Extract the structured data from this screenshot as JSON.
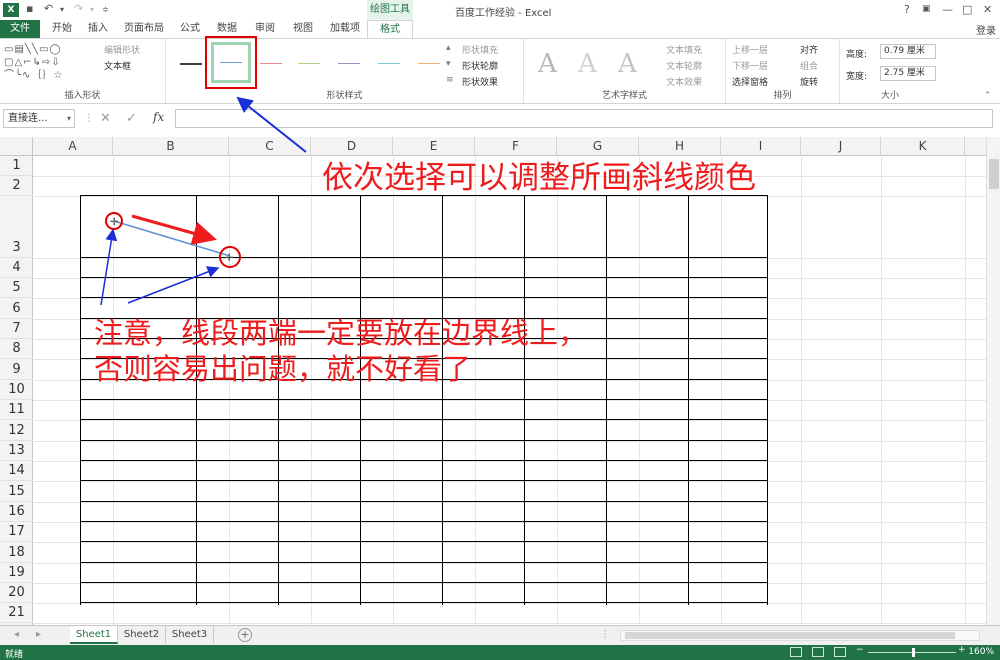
{
  "titlebar": {
    "app_icon": "X",
    "title": "百度工作经验 - Excel",
    "context_tab": "绘图工具",
    "help": "?",
    "minimize": "—",
    "restore": "□",
    "close": "✕"
  },
  "tabs": [
    "文件",
    "开始",
    "插入",
    "页面布局",
    "公式",
    "数据",
    "审阅",
    "视图",
    "加载项",
    "格式"
  ],
  "active_tab": "格式",
  "login": "登录",
  "ribbon": {
    "insert_shapes": {
      "label": "插入形状",
      "edit_shape": "编辑形状",
      "textbox": "文本框"
    },
    "shape_styles": {
      "label": "形状样式",
      "fill": "形状填充",
      "outline": "形状轮廓",
      "effects": "形状效果",
      "line_colors": [
        "#404040",
        "#6fa0d8",
        "#e88a8a",
        "#b5d18a",
        "#a08ec7",
        "#7fc7dd",
        "#f0b27a"
      ]
    },
    "wordart": {
      "label": "艺术字样式",
      "text_fill": "文本填充",
      "text_outline": "文本轮廓",
      "text_effects": "文本效果",
      "sample": "A"
    },
    "arrange": {
      "label": "排列",
      "bring_forward": "上移一层",
      "send_backward": "下移一层",
      "selection_pane": "选择窗格",
      "align": "对齐",
      "group": "组合",
      "rotate": "旋转"
    },
    "size": {
      "label": "大小",
      "height_label": "高度:",
      "height_value": "0.79 厘米",
      "width_label": "宽度:",
      "width_value": "2.75 厘米"
    }
  },
  "formula_bar": {
    "name_box": "直接连...",
    "fx": "fx",
    "content": ""
  },
  "columns": [
    "A",
    "B",
    "C",
    "D",
    "E",
    "F",
    "G",
    "H",
    "I",
    "J",
    "K"
  ],
  "rows": [
    "1",
    "2",
    "3",
    "4",
    "5",
    "6",
    "7",
    "8",
    "9",
    "10",
    "11",
    "12",
    "13",
    "14",
    "15",
    "16",
    "17",
    "18",
    "19",
    "20",
    "21"
  ],
  "annotations": {
    "top": "依次选择可以调整所画斜线颜色",
    "note_line1": "注意，线段两端一定要放在边界线上，",
    "note_line2": "否则容易出问题，就不好看了"
  },
  "sheets": [
    "Sheet1",
    "Sheet2",
    "Sheet3"
  ],
  "active_sheet": "Sheet1",
  "statusbar": {
    "ready": "就绪",
    "zoom": "160%"
  },
  "colors": {
    "excel_green": "#217346",
    "annotation_red": "#ee1c1c",
    "arrow_blue": "#1a2fd6",
    "selection_red": "#e00000"
  }
}
